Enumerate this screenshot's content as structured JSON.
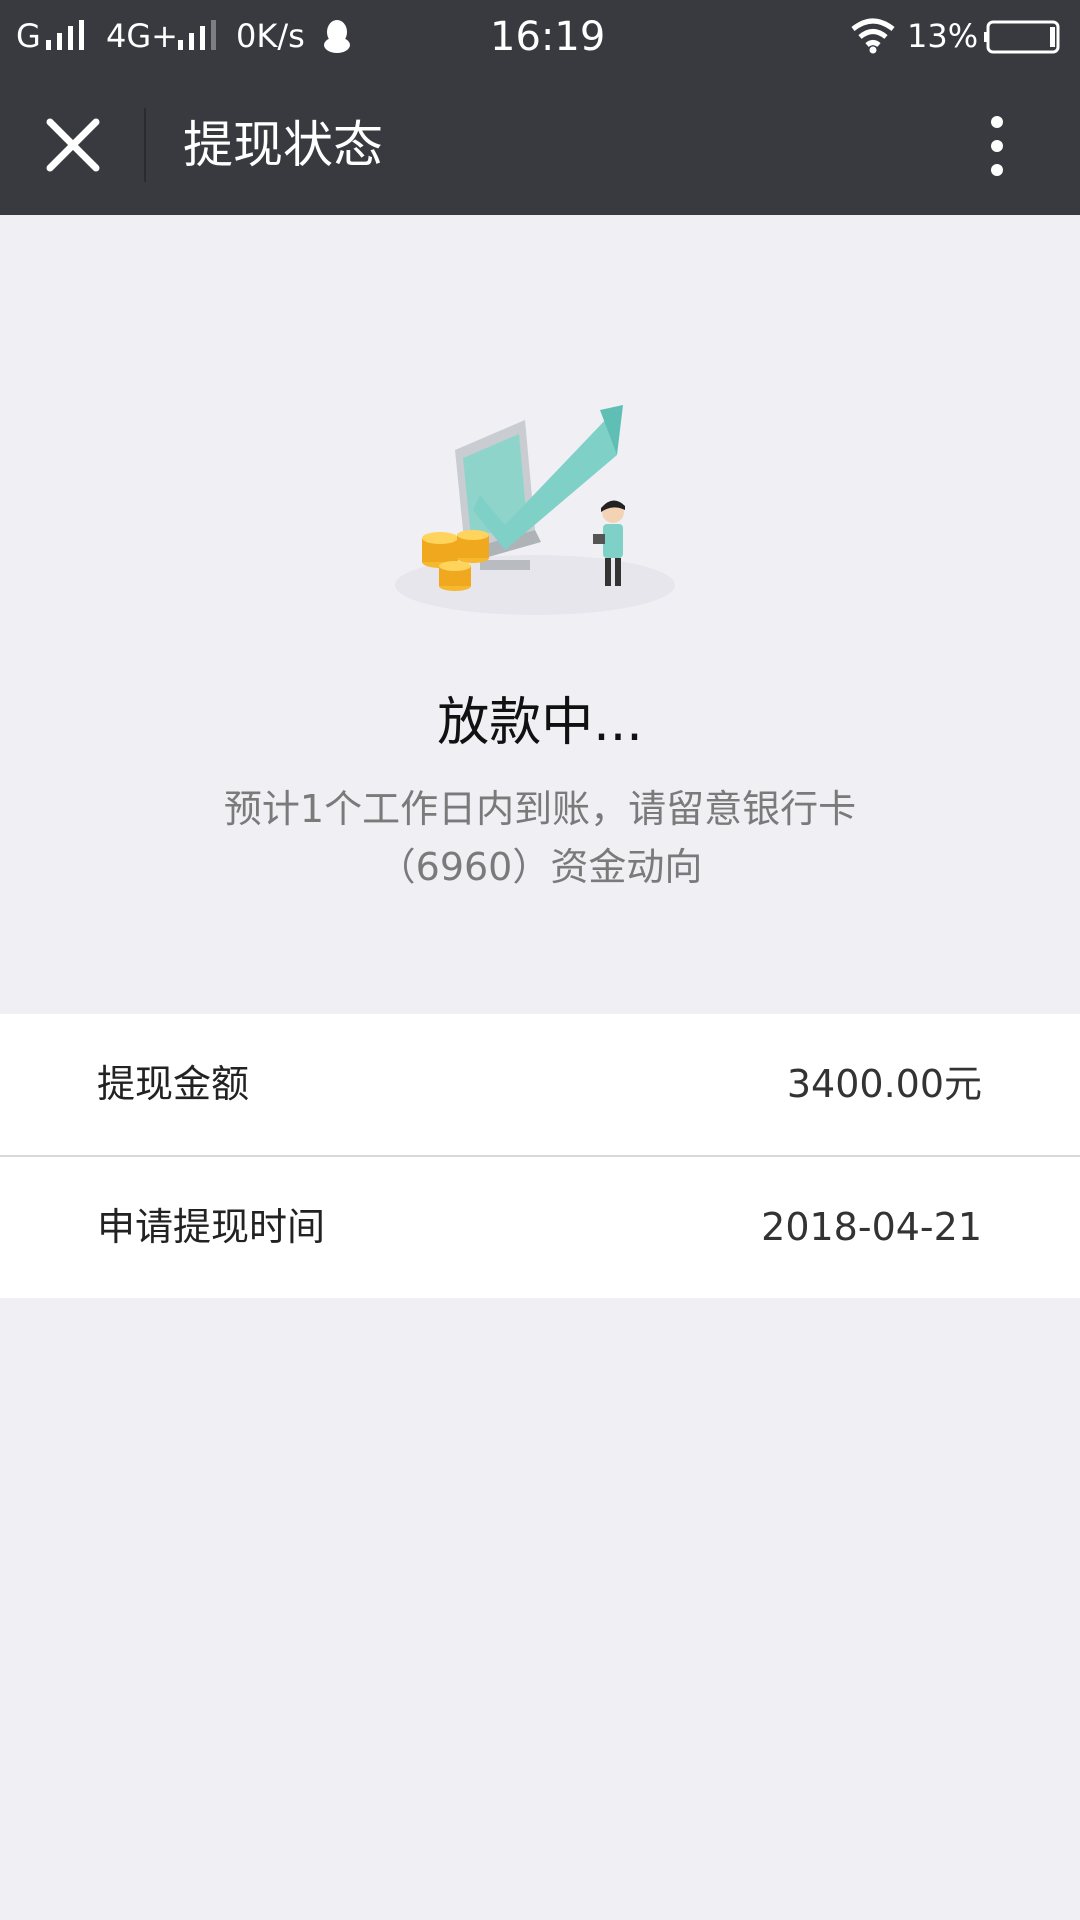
{
  "status_bar": {
    "carrier1": "G",
    "carrier2": "4G+",
    "speed": "0K/s",
    "time": "16:19",
    "battery": "13%"
  },
  "nav": {
    "title": "提现状态",
    "close_icon": "close-icon",
    "more_icon": "more-vertical-icon"
  },
  "status": {
    "title": "放款中...",
    "line1": "预计1个工作日内到账，请留意银行卡",
    "line2": "（6960）资金动向"
  },
  "details": [
    {
      "label": "提现金额",
      "value": "3400.00元"
    },
    {
      "label": "申请提现时间",
      "value": "2018-04-21"
    }
  ],
  "colors": {
    "header_bg": "#393a3f",
    "page_bg": "#efeff4",
    "accent_teal": "#7fd0c7",
    "coin_gold": "#f5b82e"
  }
}
